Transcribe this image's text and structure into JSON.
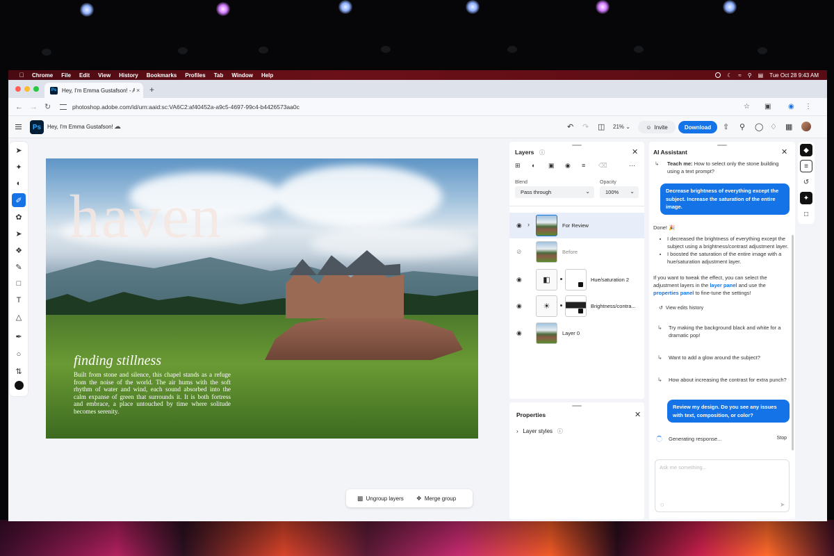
{
  "menubar": {
    "items": [
      "Chrome",
      "File",
      "Edit",
      "View",
      "History",
      "Bookmarks",
      "Profiles",
      "Tab",
      "Window",
      "Help"
    ],
    "clock": "Tue Oct 28  9:43 AM"
  },
  "browser": {
    "tab_title": "Hey, I'm Emma Gustafson! - A",
    "tab_favicon": "Ps",
    "new_tab": "+",
    "tab_close": "×",
    "url": "photoshop.adobe.com/id/urn:aaid:sc:VA6C2:af40452a-a9c5-4697-99c4-b4426573aa0c"
  },
  "ps": {
    "logo": "Ps",
    "doc_title": "Hey, I'm Emma Gustafson!",
    "zoom": "21%",
    "invite_label": "Invite",
    "download_label": "Download"
  },
  "canvas": {
    "headline": "haven",
    "subheading": "finding stillness",
    "body": "Built from stone and silence, this chapel stands as a refuge from the noise of the world. The air hums with the soft rhythm of water and wind, each sound absorbed into the calm expanse of green that surrounds it. It is both fortress and embrace, a place untouched by time where solitude becomes serenity."
  },
  "context_bar": {
    "ungroup_label": "Ungroup layers",
    "merge_label": "Merge group"
  },
  "layers_panel": {
    "title": "Layers",
    "blend_label": "Blend",
    "blend_value": "Pass through",
    "opacity_label": "Opacity",
    "opacity_value": "100%",
    "layers": [
      {
        "name": "For Review",
        "visible": true,
        "selected": true
      },
      {
        "name": "Before",
        "visible": false
      },
      {
        "name": "Hue/saturation 2",
        "visible": true
      },
      {
        "name": "Brightness/contra...",
        "visible": true
      },
      {
        "name": "Layer 0",
        "visible": true
      }
    ]
  },
  "properties_panel": {
    "title": "Properties",
    "layer_styles": "Layer styles"
  },
  "ai_assistant": {
    "title": "AI Assistant",
    "teach_label": "Teach me:",
    "teach_text": "How to select only the stone building using a text prompt?",
    "user_msg_1": "Decrease brightness of everything except the subject. Increase the saturation of the entire image.",
    "done": "Done! 🎉",
    "bullet_1": "I decreased the brightness of everything except the subject using a brightness/contrast adjustment layer.",
    "bullet_2": "I boosted the saturation of the entire image with a hue/saturation adjustment layer.",
    "tweak_pre": "If you want to tweak the effect, you can select the adjustment layers in the",
    "tweak_link1": "layer panel",
    "tweak_mid": "and use the",
    "tweak_link2": "properties panel",
    "tweak_post": "to fine-tune the settings!",
    "view_history": "View edits history",
    "suggestions": [
      "Try making the background black and white for a dramatic pop!",
      "Want to add a glow around the subject?",
      "How about increasing the contrast for extra punch?"
    ],
    "user_msg_2": "Review my design. Do you see any issues with text, composition, or color?",
    "generating": "Generating response...",
    "stop": "Stop",
    "input_placeholder": "Ask me something..."
  },
  "colors": {
    "accent": "#1473e6",
    "ps_brand": "#31a8ff",
    "ps_dark": "#001e36"
  }
}
